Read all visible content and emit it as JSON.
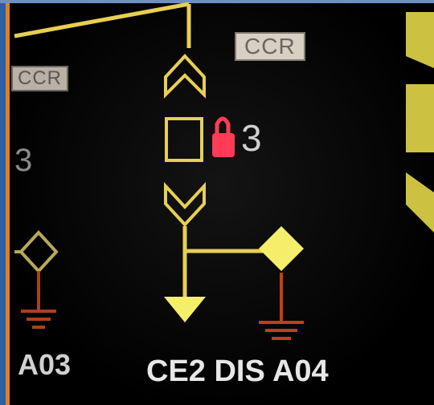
{
  "panel": {
    "tag_center": "CCR",
    "tag_left": "CCR",
    "label_center": "CE2 DIS A04",
    "label_left": "A03",
    "digit_center": "3",
    "digit_left": "3"
  },
  "colors": {
    "line": "#e7cf53",
    "symbol_fill": "#f5ee6b",
    "ground": "#c83c18",
    "lock": "#ff3b55",
    "tag_bg": "#d7d0c3",
    "text": "#e7e7e7"
  },
  "icons": {
    "lock": "lock-icon",
    "switch_open": "switch-open-icon",
    "switch_closed": "switch-closed-icon",
    "ground": "ground-icon",
    "load_arrow": "arrow-down-icon"
  }
}
